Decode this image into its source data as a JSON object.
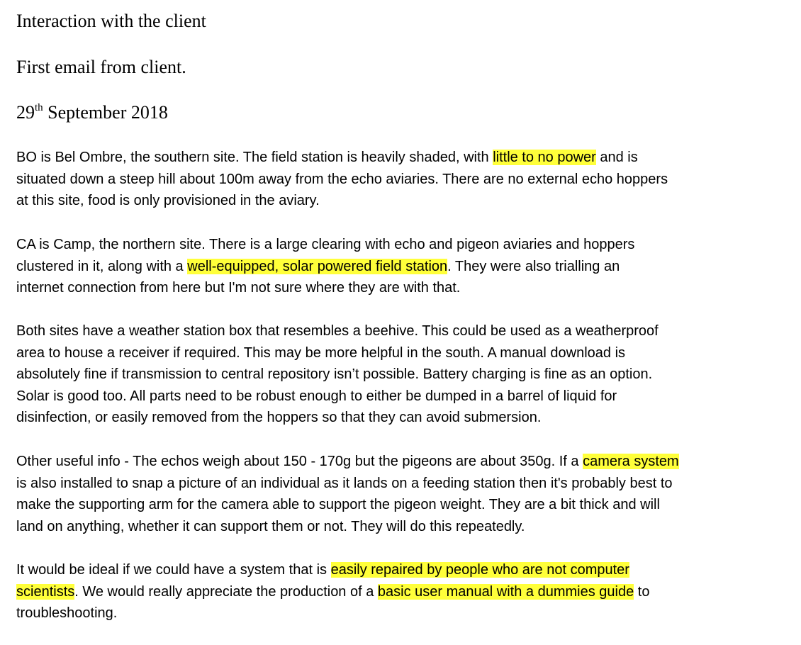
{
  "header": {
    "title": "Interaction with the client",
    "subtitle": "First email from client.",
    "date_day": "29",
    "date_suffix": "th",
    "date_rest": " September 2018"
  },
  "paragraphs": {
    "bo": {
      "l1a": "BO is Bel Ombre, the southern site. The field station is heavily shaded, with ",
      "l1hl": "little to no power",
      "l1b": " and is",
      "l2": "situated down a steep hill about 100m away from the echo aviaries. There are no external echo hoppers",
      "l3": "at this site, food is only provisioned in the aviary."
    },
    "ca": {
      "l1": "CA is Camp, the northern site. There is a large clearing with echo and pigeon aviaries and hoppers",
      "l2a": "clustered in it, along with a ",
      "l2hl": "well-equipped, solar powered field station",
      "l2b": ". They were also trialling an",
      "l3": "internet connection from here but I'm not sure where they are with that."
    },
    "both": {
      "l1": "Both sites have a weather station box that resembles a beehive. This could be used as a weatherproof",
      "l2": "area to house a receiver if required. This may be more helpful in the south. A manual download is",
      "l3": "absolutely fine if transmission to  central repository isn’t possible. Battery charging is fine as an option.",
      "l4": "Solar is good too. All parts need to be robust enough to either be dumped in a barrel of liquid for",
      "l5": "disinfection, or easily removed from the hoppers so that they can avoid submersion."
    },
    "other": {
      "l1a": "Other useful info - The echos weigh about 150 - 170g but the pigeons are about 350g. If a ",
      "l1hl": "camera system",
      "l2": "is also installed to snap a picture of an individual as it lands on a feeding station then it's probably best to",
      "l3": "make the supporting arm for the camera able to support the pigeon weight. They are a bit thick and will",
      "l4": "land on anything, whether it can support them or not. They will do this repeatedly."
    },
    "ideal": {
      "l1a": "It would be ideal if we could have a system that is ",
      "l1hl": "easily repaired by people who are not computer",
      "l2hl": "scientists",
      "l2a": ". We would really appreciate the production of a ",
      "l2hl2": "basic user manual with a dummies guide",
      "l2b": " to",
      "l3": "troubleshooting."
    }
  },
  "colors": {
    "highlight": "#ffff3a",
    "text": "#000000",
    "background": "#ffffff"
  }
}
